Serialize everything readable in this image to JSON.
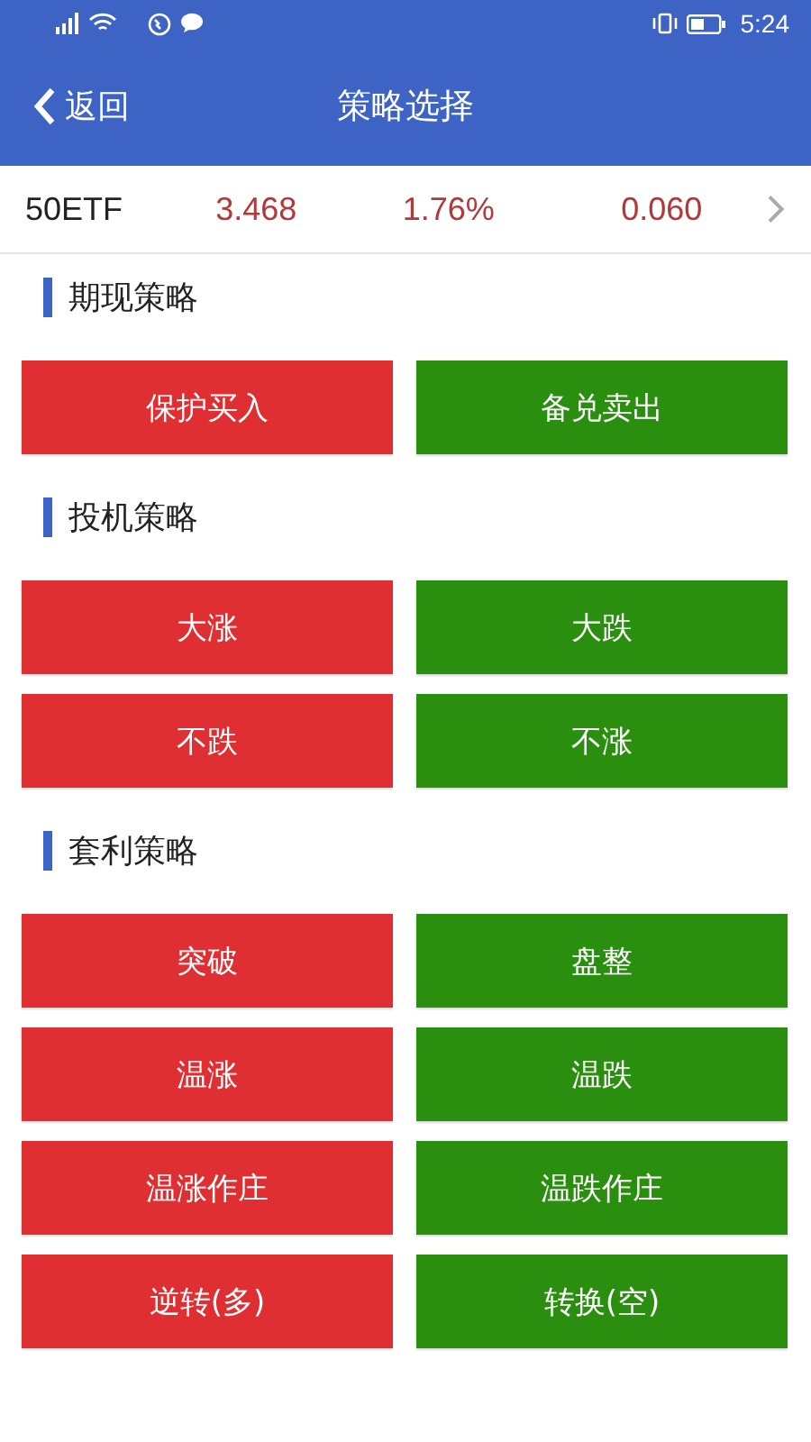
{
  "status_bar": {
    "time": "5:24"
  },
  "header": {
    "back": "返回",
    "title": "策略选择"
  },
  "quote": {
    "symbol": "50ETF",
    "price": "3.468",
    "change_percent": "1.76%",
    "change": "0.060"
  },
  "sections": [
    {
      "title": "期现策略",
      "buttons": [
        {
          "label": "保护买入",
          "kind": "up"
        },
        {
          "label": "备兑卖出",
          "kind": "down"
        }
      ]
    },
    {
      "title": "投机策略",
      "buttons": [
        {
          "label": "大涨",
          "kind": "up"
        },
        {
          "label": "大跌",
          "kind": "down"
        },
        {
          "label": "不跌",
          "kind": "up"
        },
        {
          "label": "不涨",
          "kind": "down"
        }
      ]
    },
    {
      "title": "套利策略",
      "buttons": [
        {
          "label": "突破",
          "kind": "up"
        },
        {
          "label": "盘整",
          "kind": "down"
        },
        {
          "label": "温涨",
          "kind": "up"
        },
        {
          "label": "温跌",
          "kind": "down"
        },
        {
          "label": "温涨作庄",
          "kind": "up"
        },
        {
          "label": "温跌作庄",
          "kind": "down"
        },
        {
          "label": "逆转(多)",
          "kind": "up"
        },
        {
          "label": "转换(空)",
          "kind": "down"
        }
      ]
    }
  ]
}
